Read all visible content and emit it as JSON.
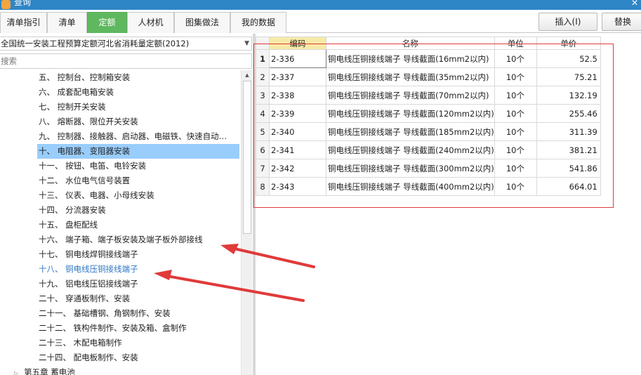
{
  "window": {
    "title": "查询"
  },
  "tabs": [
    {
      "label": "清单指引",
      "active": false
    },
    {
      "label": "清单",
      "active": false
    },
    {
      "label": "定额",
      "active": true
    },
    {
      "label": "人材机",
      "active": false
    },
    {
      "label": "图集做法",
      "active": false
    },
    {
      "label": "我的数据",
      "active": false
    }
  ],
  "toolbar": {
    "insert_label": "插入(I)",
    "replace_label": "替换"
  },
  "library": {
    "selected": "全国统一安装工程预算定额河北省消耗量定额(2012)"
  },
  "search": {
    "placeholder": "搜索",
    "value": ""
  },
  "tree": {
    "items": [
      {
        "label": "五、 控制台、控制箱安装",
        "selected": false
      },
      {
        "label": "六、 成套配电箱安装",
        "selected": false
      },
      {
        "label": "七、 控制开关安装",
        "selected": false
      },
      {
        "label": "八、 熔断器、限位开关安装",
        "selected": false
      },
      {
        "label": "九、 控制器、接触器、启动器、电磁铁、快速自动…",
        "selected": false
      },
      {
        "label": "十、 电阻器、变阻器安装",
        "selected": true
      },
      {
        "label": "十一、 按钮、电笛、电铃安装",
        "selected": false
      },
      {
        "label": "十二、 水位电气信号装置",
        "selected": false
      },
      {
        "label": "十三、 仪表、电器、小母线安装",
        "selected": false
      },
      {
        "label": "十四、 分流器安装",
        "selected": false
      },
      {
        "label": "十五、 盘柜配线",
        "selected": false
      },
      {
        "label": "十六、 端子箱、端子板安装及端子板外部接线",
        "selected": false
      },
      {
        "label": "十七、 铜电线焊铜接线端子",
        "selected": false
      },
      {
        "label": "十八、 铜电线压铜接线端子",
        "selected": false,
        "current": true
      },
      {
        "label": "十九、 铝电线压铝接线端子",
        "selected": false
      },
      {
        "label": "二十、 穿通板制作、安装",
        "selected": false
      },
      {
        "label": "二十一、 基础槽钢、角钢制作、安装",
        "selected": false
      },
      {
        "label": "二十二、 铁构件制作、安装及箱、盒制作",
        "selected": false
      },
      {
        "label": "二十三、 木配电箱制作",
        "selected": false
      },
      {
        "label": "二十四、 配电板制作、安装",
        "selected": false
      }
    ],
    "parent": {
      "label": "第五章 蓄电池"
    }
  },
  "grid": {
    "columns": {
      "code": "编码",
      "name": "名称",
      "unit": "单位",
      "price": "单价"
    },
    "rows": [
      {
        "no": "1",
        "code": "2-336",
        "name": "铜电线压铜接线端子 导线截面(16mm2以内)",
        "unit": "10个",
        "price": "52.5"
      },
      {
        "no": "2",
        "code": "2-337",
        "name": "铜电线压铜接线端子 导线截面(35mm2以内)",
        "unit": "10个",
        "price": "75.21"
      },
      {
        "no": "3",
        "code": "2-338",
        "name": "铜电线压铜接线端子 导线截面(70mm2以内)",
        "unit": "10个",
        "price": "132.19"
      },
      {
        "no": "4",
        "code": "2-339",
        "name": "铜电线压铜接线端子 导线截面(120mm2以内)",
        "unit": "10个",
        "price": "255.46"
      },
      {
        "no": "5",
        "code": "2-340",
        "name": "铜电线压铜接线端子 导线截面(185mm2以内)",
        "unit": "10个",
        "price": "311.39"
      },
      {
        "no": "6",
        "code": "2-341",
        "name": "铜电线压铜接线端子 导线截面(240mm2以内)",
        "unit": "10个",
        "price": "381.21"
      },
      {
        "no": "7",
        "code": "2-342",
        "name": "铜电线压铜接线端子 导线截面(300mm2以内)",
        "unit": "10个",
        "price": "541.86"
      },
      {
        "no": "8",
        "code": "2-343",
        "name": "铜电线压铜接线端子 导线截面(400mm2以内)",
        "unit": "10个",
        "price": "664.01"
      }
    ]
  },
  "colors": {
    "active_tab": "#5fb85f",
    "selected_row": "#99cdfb",
    "annotation_red": "#e03a3a",
    "code_header": "#f6eaa8"
  }
}
